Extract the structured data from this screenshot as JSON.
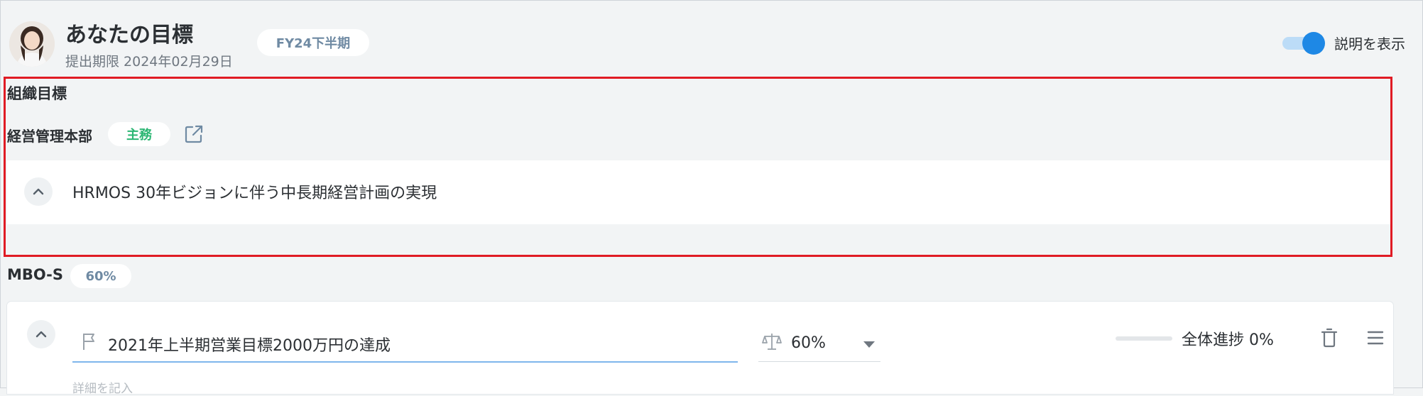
{
  "header": {
    "title": "あなたの目標",
    "deadline": "提出期限 2024年02月29日",
    "period_badge": "FY24下半期",
    "toggle_label": "説明を表示",
    "toggle_on": true
  },
  "org_goals": {
    "section_title": "組織目標",
    "department": "経営管理本部",
    "role_badge": "主務",
    "goal": "HRMOS 30年ビジョンに伴う中長期経営計画の実現"
  },
  "mbo": {
    "section_title": "MBO-S",
    "weight_badge": "60%",
    "items": [
      {
        "title": "2021年上半期営業目標2000万円の達成",
        "weight": "60%",
        "progress_label": "全体進捗 0%",
        "progress": 0,
        "description_placeholder": "詳細を記入"
      }
    ]
  },
  "icons": {
    "avatar": "user-avatar",
    "external": "external-link-icon",
    "chevron": "chevron-up-icon",
    "flag": "flag-icon",
    "scale": "scale-icon",
    "trash": "trash-icon",
    "menu": "menu-icon"
  },
  "colors": {
    "accent": "#1e88e5",
    "main_badge_text": "#2bb673",
    "highlight_border": "#e01b24"
  }
}
